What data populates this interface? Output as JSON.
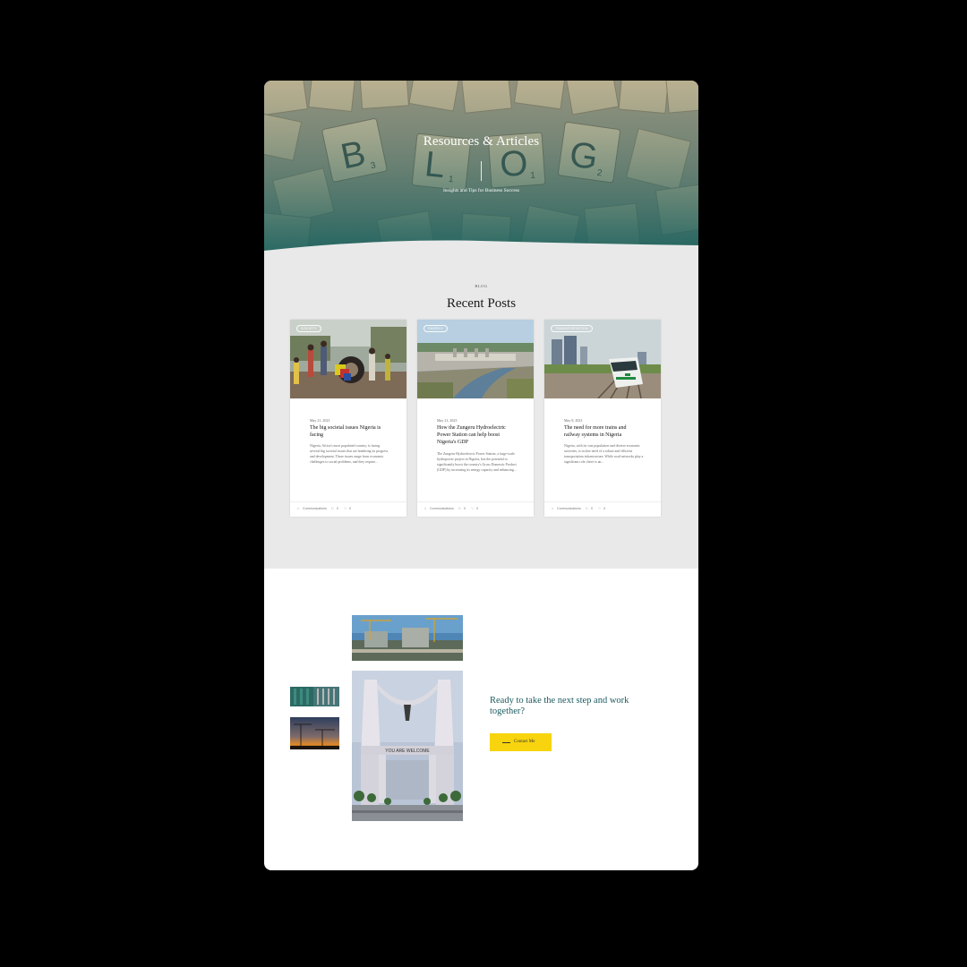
{
  "hero": {
    "title": "Resources & Articles",
    "subtitle": "Insights and Tips for Business Success",
    "tile_letters": [
      "B",
      "L",
      "O",
      "G"
    ],
    "tile_numbers": [
      "3",
      "1",
      "1",
      "2"
    ]
  },
  "blog": {
    "eyebrow": "BLOG",
    "heading_plain": "Recent ",
    "heading_highlight": "Posts",
    "highlight_colors": [
      "#1f6c72",
      "#2e8b57",
      "#f2c500"
    ],
    "posts": [
      {
        "tag": "SOCIETY",
        "date": "May 21, 2023",
        "title": "The big societal issues Nigeria is facing",
        "excerpt": "Nigeria, Africa's most populated country, is facing several big societal issues that are hindering its progress and development. These issues range from economic challenges to social problems, and they require...",
        "author": "Communications",
        "comments": "0",
        "likes": "0"
      },
      {
        "tag": "ENERGY",
        "date": "May 21, 2023",
        "title": "How the Zungeru Hydroelectric Power Station can help boost Nigeria's GDP",
        "excerpt": "The Zungeru Hydroelectric Power Station, a large-scale hydropower project in Nigeria, has the potential to significantly boost the country's Gross Domestic Product (GDP) by increasing its energy capacity and enhancing...",
        "author": "Communications",
        "comments": "0",
        "likes": "0"
      },
      {
        "tag": "TRANSPORTATION",
        "date": "May 8, 2023",
        "title": "The need for more trains and railway systems in Nigeria",
        "excerpt": "Nigeria, with its vast population and diverse economic activities, is in dire need of a robust and efficient transportation infrastructure. While road networks play a significant role, there is an...",
        "author": "Communications",
        "comments": "0",
        "likes": "0"
      }
    ]
  },
  "cta": {
    "heading": "Ready to take the next step and work together?",
    "button_label": "Contact Me",
    "button_color": "#f7d40d",
    "gate_text": "YOU ARE WELCOME"
  },
  "colors": {
    "background": "#000000",
    "hero_teal": "#2d5d5a",
    "section_gray": "#e9e9e9",
    "cta_text": "#1c5a5f"
  }
}
